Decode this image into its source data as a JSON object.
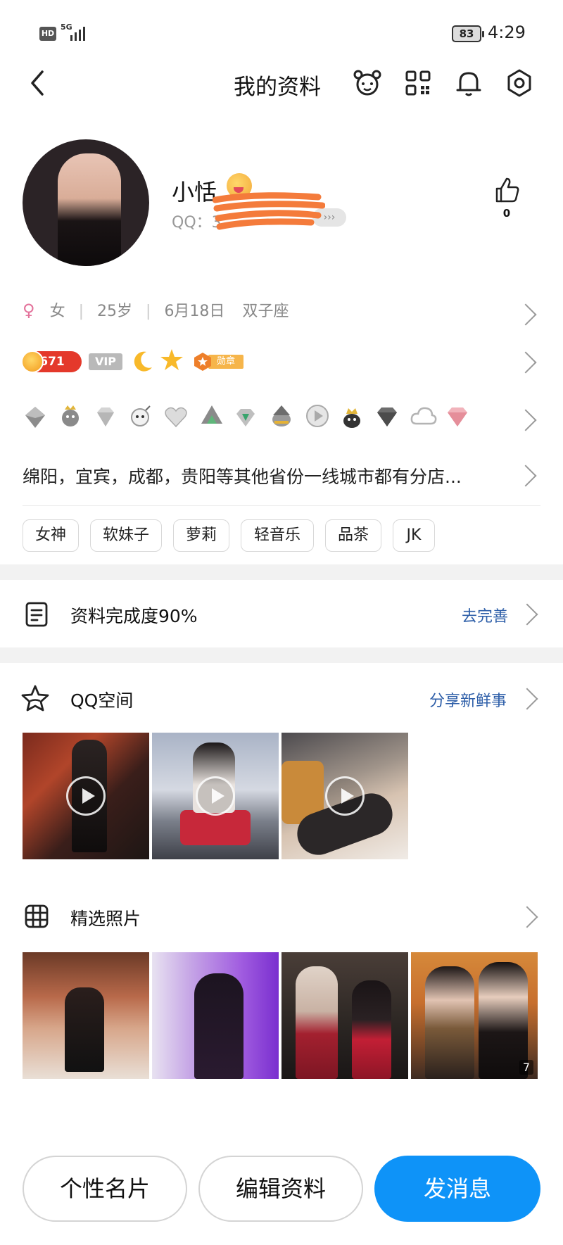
{
  "status_bar": {
    "hd": "HD",
    "network": "5G",
    "battery": "83",
    "time": "4:29"
  },
  "nav": {
    "title": "我的资料",
    "icons": [
      "back-icon",
      "pet-icon",
      "qr-code-icon",
      "bell-icon",
      "settings-icon"
    ]
  },
  "profile": {
    "name": "小恬",
    "qq_prefix": "QQ：3",
    "qq_chip": "›››",
    "likes": "0"
  },
  "basic_info": {
    "gender_symbol": "♀",
    "gender": "女",
    "age": "25岁",
    "birthday": "6月18日",
    "zodiac": "双子座"
  },
  "level": {
    "points": "671",
    "vip": "VIP",
    "medal": "勋章"
  },
  "location_text": "绵阳，宜宾，成都，贵阳等其他省份一线城市都有分店...",
  "tags": [
    "女神",
    "软妹子",
    "萝莉",
    "轻音乐",
    "品茶",
    "JK"
  ],
  "completion": {
    "label": "资料完成度90%",
    "action": "去完善"
  },
  "qzone": {
    "label": "QQ空间",
    "action": "分享新鲜事"
  },
  "featured": {
    "label": "精选照片",
    "photo_count": "7"
  },
  "buttons": {
    "card": "个性名片",
    "edit": "编辑资料",
    "message": "发消息"
  },
  "colors": {
    "accent": "#0e93f8",
    "link": "#2d5ea8",
    "gender": "#e3739b",
    "level_badge": "#e4392b"
  }
}
